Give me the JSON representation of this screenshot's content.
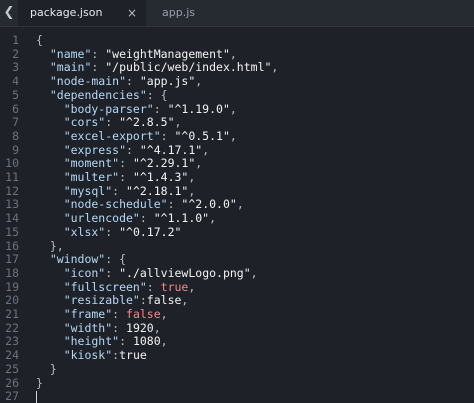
{
  "tabs": [
    {
      "label": "package.json",
      "active": true,
      "close_icon": "×"
    },
    {
      "label": "app.js",
      "active": false
    }
  ],
  "tab_scroll_icon": "❮",
  "editor": {
    "line_numbers": [
      "1",
      "2",
      "3",
      "4",
      "5",
      "6",
      "7",
      "8",
      "9",
      "10",
      "11",
      "12",
      "13",
      "14",
      "15",
      "16",
      "17",
      "18",
      "19",
      "20",
      "21",
      "22",
      "23",
      "24",
      "25",
      "26",
      "27"
    ],
    "lines": [
      [
        [
          "{",
          "punc"
        ]
      ],
      [
        [
          "  \"name\"",
          "key"
        ],
        [
          ": ",
          "punc"
        ],
        [
          "\"weightManagement\"",
          "str"
        ],
        [
          ",",
          "punc"
        ]
      ],
      [
        [
          "  \"main\"",
          "key"
        ],
        [
          ": ",
          "punc"
        ],
        [
          "\"/public/web/index.html\"",
          "str"
        ],
        [
          ",",
          "punc"
        ]
      ],
      [
        [
          "  \"node-main\"",
          "key"
        ],
        [
          ": ",
          "punc"
        ],
        [
          "\"app.js\"",
          "str"
        ],
        [
          ",",
          "punc"
        ]
      ],
      [
        [
          "  \"dependencies\"",
          "key"
        ],
        [
          ": {",
          "punc"
        ]
      ],
      [
        [
          "    \"body-parser\"",
          "key"
        ],
        [
          ": ",
          "punc"
        ],
        [
          "\"^1.19.0\"",
          "str"
        ],
        [
          ",",
          "punc"
        ]
      ],
      [
        [
          "    \"cors\"",
          "key"
        ],
        [
          ": ",
          "punc"
        ],
        [
          "\"^2.8.5\"",
          "str"
        ],
        [
          ",",
          "punc"
        ]
      ],
      [
        [
          "    \"excel-export\"",
          "key"
        ],
        [
          ": ",
          "punc"
        ],
        [
          "\"^0.5.1\"",
          "str"
        ],
        [
          ",",
          "punc"
        ]
      ],
      [
        [
          "    \"express\"",
          "key"
        ],
        [
          ": ",
          "punc"
        ],
        [
          "\"^4.17.1\"",
          "str"
        ],
        [
          ",",
          "punc"
        ]
      ],
      [
        [
          "    \"moment\"",
          "key"
        ],
        [
          ": ",
          "punc"
        ],
        [
          "\"^2.29.1\"",
          "str"
        ],
        [
          ",",
          "punc"
        ]
      ],
      [
        [
          "    \"multer\"",
          "key"
        ],
        [
          ": ",
          "punc"
        ],
        [
          "\"^1.4.3\"",
          "str"
        ],
        [
          ",",
          "punc"
        ]
      ],
      [
        [
          "    \"mysql\"",
          "key"
        ],
        [
          ": ",
          "punc"
        ],
        [
          "\"^2.18.1\"",
          "str"
        ],
        [
          ",",
          "punc"
        ]
      ],
      [
        [
          "    \"node-schedule\"",
          "key"
        ],
        [
          ": ",
          "punc"
        ],
        [
          "\"^2.0.0\"",
          "str"
        ],
        [
          ",",
          "punc"
        ]
      ],
      [
        [
          "    \"urlencode\"",
          "key"
        ],
        [
          ": ",
          "punc"
        ],
        [
          "\"^1.1.0\"",
          "str"
        ],
        [
          ",",
          "punc"
        ]
      ],
      [
        [
          "    \"xlsx\"",
          "key"
        ],
        [
          ": ",
          "punc"
        ],
        [
          "\"^0.17.2\"",
          "str"
        ]
      ],
      [
        [
          "  },",
          "punc"
        ]
      ],
      [
        [
          "  \"window\"",
          "key"
        ],
        [
          ": {",
          "punc"
        ]
      ],
      [
        [
          "    \"icon\"",
          "key"
        ],
        [
          ": ",
          "punc"
        ],
        [
          "\"./allviewLogo.png\"",
          "str"
        ],
        [
          ",",
          "punc"
        ]
      ],
      [
        [
          "    \"fullscreen\"",
          "key"
        ],
        [
          ": ",
          "punc"
        ],
        [
          "true",
          "bool"
        ],
        [
          ",",
          "punc"
        ]
      ],
      [
        [
          "    \"resizable\"",
          "key"
        ],
        [
          ":",
          "punc"
        ],
        [
          "false",
          "str"
        ],
        [
          ",",
          "punc"
        ]
      ],
      [
        [
          "    \"frame\"",
          "key"
        ],
        [
          ": ",
          "punc"
        ],
        [
          "false",
          "bool"
        ],
        [
          ",",
          "punc"
        ]
      ],
      [
        [
          "    \"width\"",
          "key"
        ],
        [
          ": ",
          "punc"
        ],
        [
          "1920",
          "num"
        ],
        [
          ",",
          "punc"
        ]
      ],
      [
        [
          "    \"height\"",
          "key"
        ],
        [
          ": ",
          "punc"
        ],
        [
          "1080",
          "num"
        ],
        [
          ",",
          "punc"
        ]
      ],
      [
        [
          "    \"kiosk\"",
          "key"
        ],
        [
          ":",
          "punc"
        ],
        [
          "true",
          "str"
        ]
      ],
      [
        [
          "  }",
          "punc"
        ]
      ],
      [
        [
          "}",
          "punc"
        ]
      ],
      [
        [
          "",
          "punc"
        ]
      ]
    ]
  },
  "colors": {
    "background": "#1e2128",
    "tabbar": "#262a31",
    "key": "#b4d8f6",
    "string": "#f3f3f3",
    "boolean": "#f08a8a",
    "line_number": "#6b7280"
  }
}
